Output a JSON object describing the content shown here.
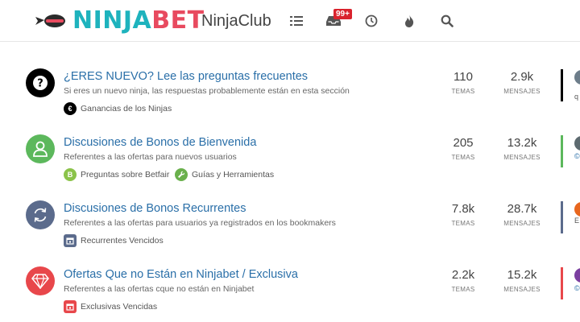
{
  "header": {
    "logo_ninja": "NINJA",
    "logo_bet": "BET",
    "site_name": "NinjaClub",
    "notification_badge": "99+",
    "nav_icons": [
      "list-icon",
      "inbox-icon",
      "clock-icon",
      "fire-icon",
      "search-icon"
    ]
  },
  "categories": [
    {
      "title": "¿ERES NUEVO? Lee las preguntas frecuentes",
      "description": "Si eres un nuevo ninja, las respuestas probablemente están en esta sección",
      "icon": "question-icon",
      "color": "#000000",
      "topics": "110",
      "topics_label": "TEMAS",
      "posts": "2.9k",
      "posts_label": "MENSAJES",
      "subcategories": [
        {
          "label": "Ganancias de los Ninjas",
          "icon": "euro-icon",
          "color": "#000000"
        }
      ],
      "teaser_text": "q"
    },
    {
      "title": "Discusiones de Bonos de Bienvenida",
      "description": "Referentes a las ofertas para nuevos usuarios",
      "icon": "user-icon",
      "color": "#5cb85c",
      "topics": "205",
      "topics_label": "TEMAS",
      "posts": "13.2k",
      "posts_label": "MENSAJES",
      "subcategories": [
        {
          "label": "Preguntas sobre Betfair",
          "icon": "letter-b-icon",
          "glyph": "B",
          "color": "#8bc34a"
        },
        {
          "label": "Guías y Herramientas",
          "icon": "wrench-icon",
          "color": "#6ab04c"
        }
      ],
      "teaser_text": "©"
    },
    {
      "title": "Discusiones de Bonos Recurrentes",
      "description": "Referentes a las ofertas para usuarios ya registrados en los bookmakers",
      "icon": "refresh-icon",
      "color": "#5b6b8c",
      "topics": "7.8k",
      "topics_label": "TEMAS",
      "posts": "28.7k",
      "posts_label": "MENSAJES",
      "subcategories": [
        {
          "label": "Recurrentes Vencidos",
          "icon": "calendar-icon",
          "color": "#5b6b8c"
        }
      ],
      "teaser_text": "E"
    },
    {
      "title": "Ofertas Que no Están en Ninjabet / Exclusiva",
      "description": "Referentes a las ofertas cque no están en Ninjabet",
      "icon": "diamond-icon",
      "color": "#e8474b",
      "topics": "2.2k",
      "topics_label": "TEMAS",
      "posts": "15.2k",
      "posts_label": "MENSAJES",
      "subcategories": [
        {
          "label": "Exclusivas Vencidas",
          "icon": "calendar-icon",
          "color": "#e8474b"
        }
      ],
      "teaser_text": "©"
    }
  ],
  "colors": {
    "brand_teal": "#1eb3bd",
    "brand_red": "#e84a5f",
    "link_blue": "#2a6fa8"
  }
}
